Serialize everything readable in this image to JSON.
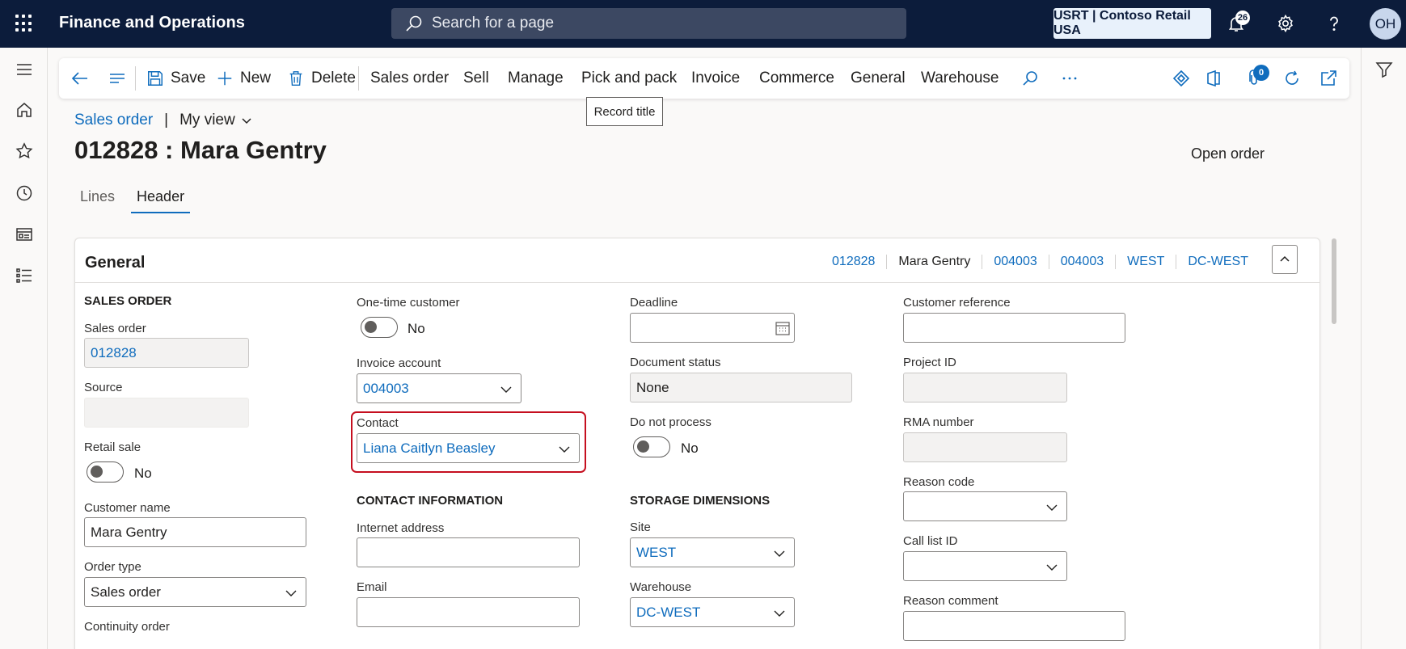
{
  "topbar": {
    "app_title": "Finance and Operations",
    "search_placeholder": "Search for a page",
    "company": "USRT | Contoso Retail USA",
    "notifications_count": "26",
    "avatar_initials": "OH"
  },
  "actionpane": {
    "save": "Save",
    "new": "New",
    "delete": "Delete",
    "menus": [
      "Sales order",
      "Sell",
      "Manage",
      "Pick and pack",
      "Invoice",
      "Commerce",
      "General",
      "Warehouse"
    ],
    "attachments_count": "0",
    "tooltip": "Record title"
  },
  "breadcrumb": {
    "link": "Sales order",
    "separator": "|",
    "view": "My view"
  },
  "page": {
    "title": "012828 : Mara Gentry",
    "status": "Open order"
  },
  "tabs": [
    "Lines",
    "Header"
  ],
  "general": {
    "title": "General",
    "summary": [
      "012828",
      "Mara Gentry",
      "004003",
      "004003",
      "WEST",
      "DC-WEST"
    ]
  },
  "col1": {
    "section": "SALES ORDER",
    "sales_order_label": "Sales order",
    "sales_order_value": "012828",
    "source_label": "Source",
    "source_value": "",
    "retail_sale_label": "Retail sale",
    "retail_sale_value": "No",
    "customer_name_label": "Customer name",
    "customer_name_value": "Mara Gentry",
    "order_type_label": "Order type",
    "order_type_value": "Sales order",
    "continuity_label": "Continuity order"
  },
  "col2": {
    "one_time_label": "One-time customer",
    "one_time_value": "No",
    "invoice_account_label": "Invoice account",
    "invoice_account_value": "004003",
    "contact_label": "Contact",
    "contact_value": "Liana Caitlyn Beasley",
    "section": "CONTACT INFORMATION",
    "internet_label": "Internet address",
    "internet_value": "",
    "email_label": "Email",
    "email_value": ""
  },
  "col3": {
    "deadline_label": "Deadline",
    "deadline_value": "",
    "doc_status_label": "Document status",
    "doc_status_value": "None",
    "do_not_process_label": "Do not process",
    "do_not_process_value": "No",
    "section": "STORAGE DIMENSIONS",
    "site_label": "Site",
    "site_value": "WEST",
    "warehouse_label": "Warehouse",
    "warehouse_value": "DC-WEST"
  },
  "col4": {
    "customer_ref_label": "Customer reference",
    "customer_ref_value": "",
    "project_label": "Project ID",
    "project_value": "",
    "rma_label": "RMA number",
    "rma_value": "",
    "reason_code_label": "Reason code",
    "reason_code_value": "",
    "call_list_label": "Call list ID",
    "call_list_value": "",
    "reason_comment_label": "Reason comment",
    "reason_comment_value": ""
  },
  "colors": {
    "nav_bg": "#0c1c3b",
    "link": "#0f6cbd",
    "focus": "#c50f1f"
  }
}
